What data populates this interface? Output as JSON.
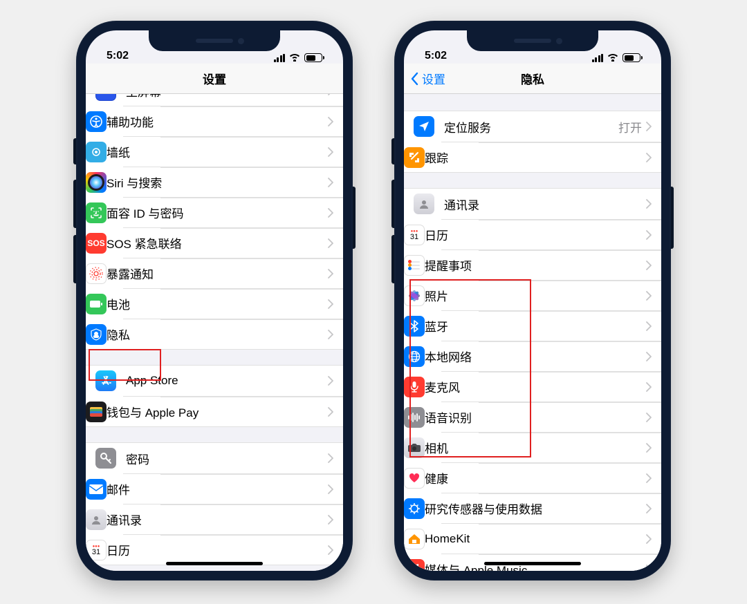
{
  "status": {
    "time": "5:02"
  },
  "left": {
    "nav_title": "设置",
    "groups": [
      [
        {
          "id": "home-screen",
          "label": "主屏幕"
        },
        {
          "id": "accessibility",
          "label": "辅助功能"
        },
        {
          "id": "wallpaper",
          "label": "墙纸"
        },
        {
          "id": "siri",
          "label": "Siri 与搜索"
        },
        {
          "id": "faceid",
          "label": "面容 ID 与密码"
        },
        {
          "id": "sos",
          "label": "SOS 紧急联络"
        },
        {
          "id": "exposure",
          "label": "暴露通知"
        },
        {
          "id": "battery",
          "label": "电池"
        },
        {
          "id": "privacy",
          "label": "隐私"
        }
      ],
      [
        {
          "id": "appstore",
          "label": "App Store"
        },
        {
          "id": "wallet",
          "label": "钱包与 Apple Pay"
        }
      ],
      [
        {
          "id": "passwords",
          "label": "密码"
        },
        {
          "id": "mail",
          "label": "邮件"
        },
        {
          "id": "contacts-l",
          "label": "通讯录"
        },
        {
          "id": "calendar-l",
          "label": "日历"
        }
      ]
    ]
  },
  "right": {
    "nav_back": "设置",
    "nav_title": "隐私",
    "groups": [
      [
        {
          "id": "location",
          "label": "定位服务",
          "detail": "打开"
        },
        {
          "id": "tracking",
          "label": "跟踪"
        }
      ],
      [
        {
          "id": "contacts",
          "label": "通讯录"
        },
        {
          "id": "calendar",
          "label": "日历"
        },
        {
          "id": "reminders",
          "label": "提醒事项"
        },
        {
          "id": "photos",
          "label": "照片"
        },
        {
          "id": "bluetooth",
          "label": "蓝牙"
        },
        {
          "id": "localnet",
          "label": "本地网络"
        },
        {
          "id": "mic",
          "label": "麦克风"
        },
        {
          "id": "speech",
          "label": "语音识别"
        },
        {
          "id": "camera",
          "label": "相机"
        },
        {
          "id": "health",
          "label": "健康"
        },
        {
          "id": "sensors",
          "label": "研究传感器与使用数据"
        },
        {
          "id": "homekit",
          "label": "HomeKit"
        },
        {
          "id": "media",
          "label": "媒体与 Apple Music"
        }
      ]
    ]
  }
}
